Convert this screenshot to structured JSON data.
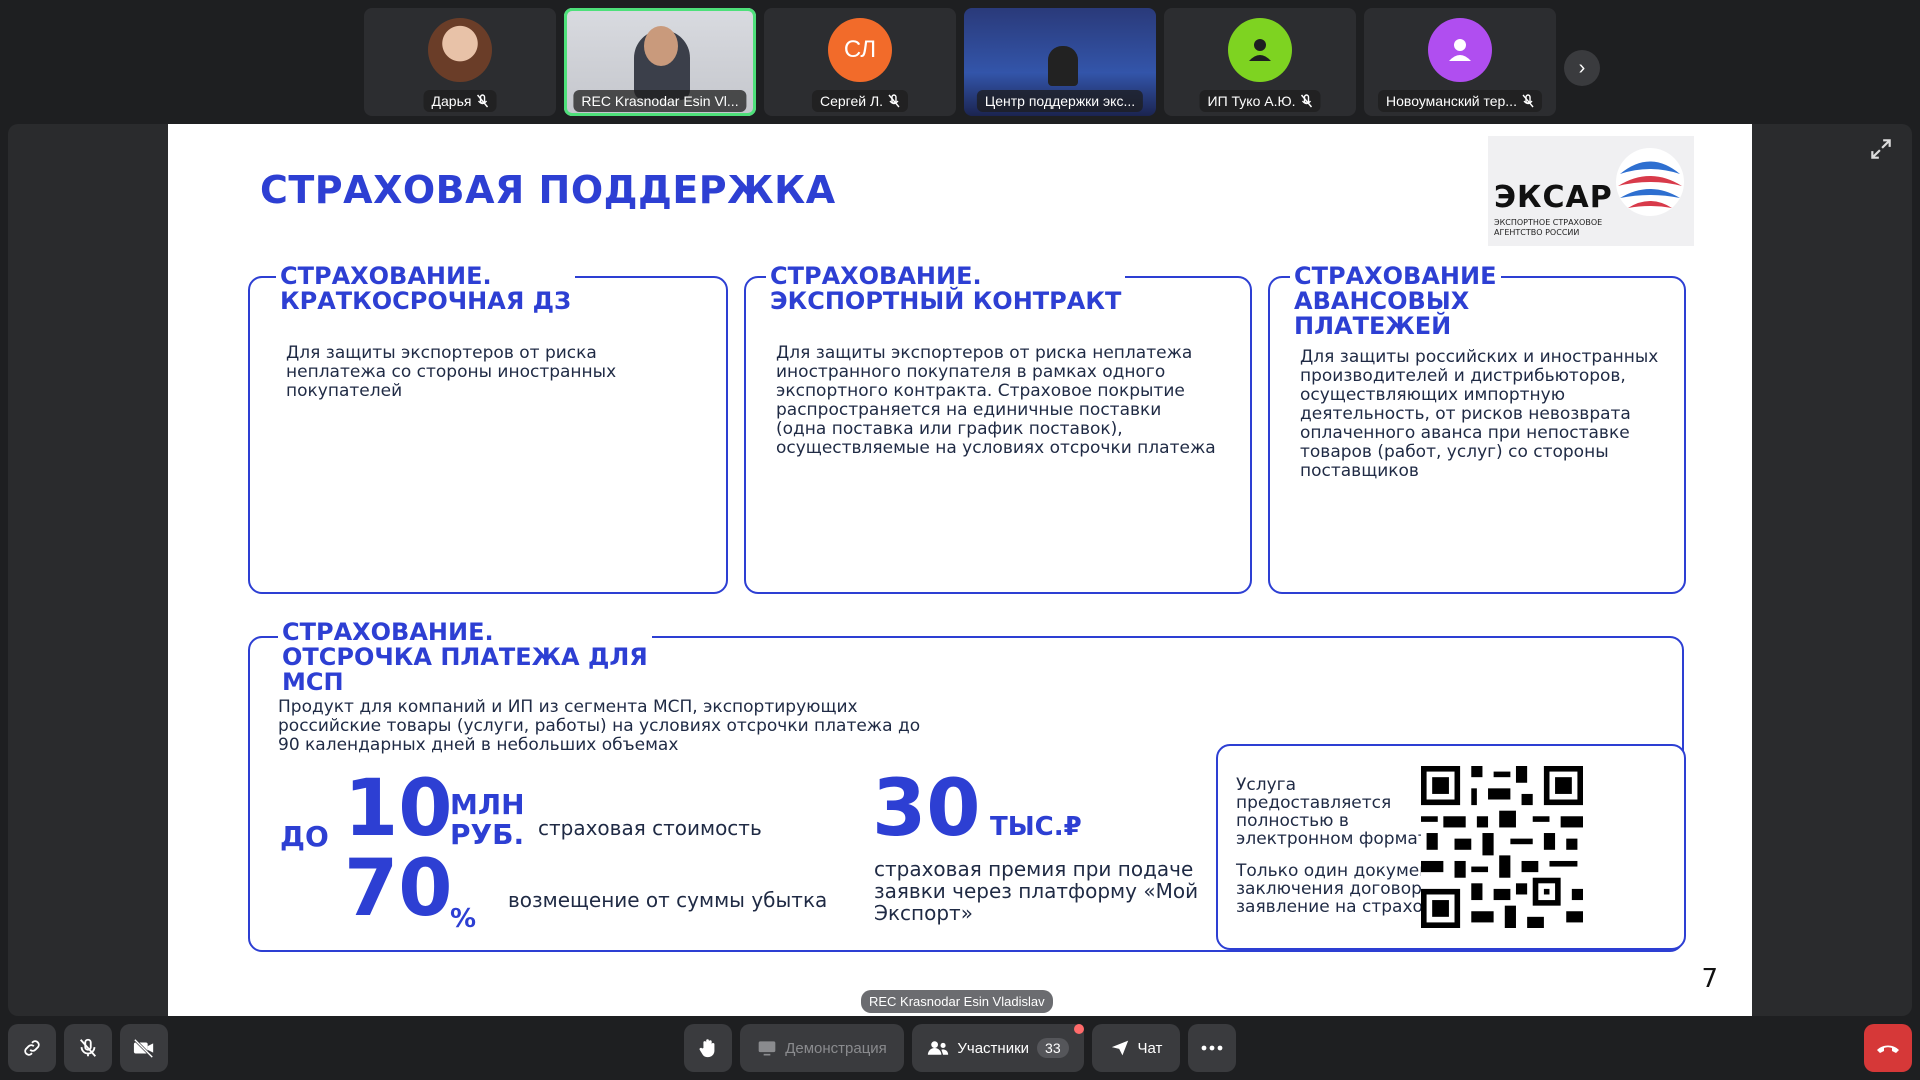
{
  "participants": [
    {
      "name": "Дарья",
      "type": "photo"
    },
    {
      "name": "REC Krasnodar Esin Vl...",
      "type": "video",
      "active": true
    },
    {
      "name": "Сергей Л.",
      "type": "initials",
      "initials": "СЛ",
      "color": "#f26b2a"
    },
    {
      "name": "Центр поддержки экс...",
      "type": "video"
    },
    {
      "name": "ИП Туко А.Ю.",
      "type": "icon",
      "color": "#7ed321"
    },
    {
      "name": "Новоуманский тер...",
      "type": "icon",
      "color": "#b04ef0"
    }
  ],
  "slide": {
    "title": "СТРАХОВАЯ ПОДДЕРЖКА",
    "logo": {
      "word": "ЭКСАР",
      "subtitle": "ЭКСПОРТНОЕ СТРАХОВОЕ АГЕНТСТВО РОССИИ"
    },
    "cards": [
      {
        "title1": "СТРАХОВАНИЕ.",
        "title2": "КРАТКОСРОЧНАЯ ДЗ",
        "text": "Для защиты экспортеров от риска неплатежа со стороны иностранных покупателей"
      },
      {
        "title1": "СТРАХОВАНИЕ.",
        "title2": "ЭКСПОРТНЫЙ КОНТРАКТ",
        "text": "Для защиты экспортеров от риска неплатежа иностранного покупателя в рамках одного экспортного контракта. Страховое покрытие распространяется на единичные поставки (одна поставка или график поставок), осуществляемые на условиях отсрочки платежа"
      },
      {
        "title1": "СТРАХОВАНИЕ",
        "title2": "АВАНСОВЫХ",
        "title3": "ПЛАТЕЖЕЙ",
        "text": "Для защиты российских и иностранных производителей и дистрибьюторов, осуществляющих импортную деятельность, от рисков невозврата оплаченного аванса при непоставке товаров (работ, услуг) со стороны поставщиков"
      }
    ],
    "msp": {
      "title1": "СТРАХОВАНИЕ.",
      "title2": "ОТСРОЧКА ПЛАТЕЖА ДЛЯ",
      "title3": "МСП",
      "text": "Продукт для компаний и ИП из сегмента МСП, экспортирующих российские товары (услуги, работы) на условиях отсрочки платежа до 90 календарных дней в небольших объемах",
      "upto": "ДО",
      "amount": "10",
      "amount_unit1": "МЛН",
      "amount_unit2": "РУБ.",
      "amount_label": "страховая стоимость",
      "percent": "70",
      "percent_unit": "%",
      "percent_label": "возмещение от суммы убытка",
      "premium": "30",
      "premium_unit": "ТЫС.₽",
      "premium_label": "страховая премия при подаче заявки через платформу «Мой Экспорт»",
      "qr_text1": "Услуга предоставляется полностью в электронном формате",
      "qr_text2": "Только один документ для заключения договора — заявление на страхование"
    },
    "page_number": "7"
  },
  "presenter_tag": "REC Krasnodar Esin Vladislav",
  "controls": {
    "demo_label": "Демонстрация",
    "participants_label": "Участники",
    "participants_count": "33",
    "chat_label": "Чат"
  }
}
